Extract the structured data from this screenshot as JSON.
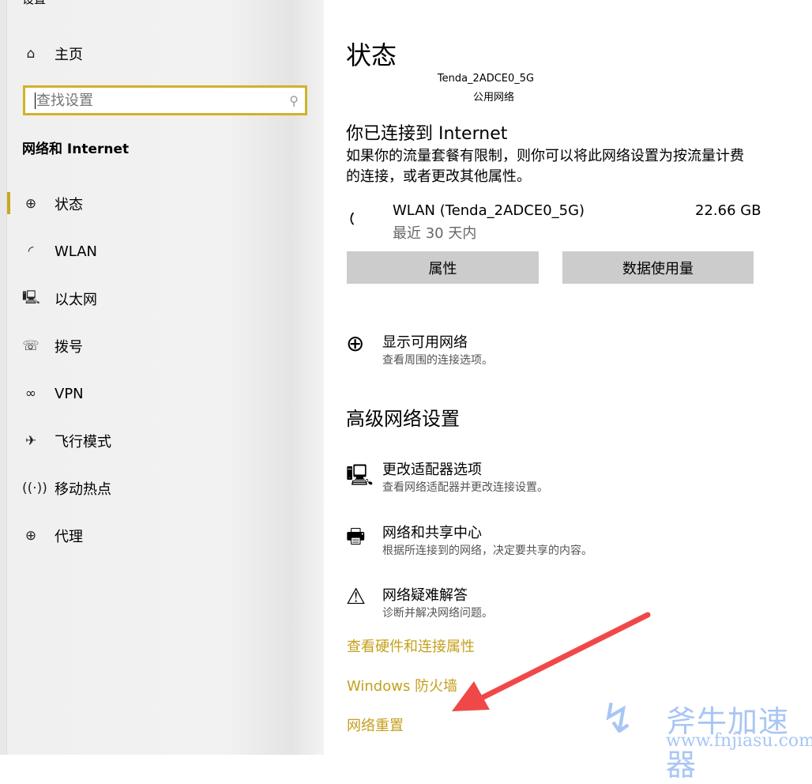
{
  "app": {
    "title": "设置"
  },
  "sidebar": {
    "home": "主页",
    "search_placeholder": "查找设置",
    "section": "网络和 Internet",
    "items": [
      {
        "label": "状态",
        "icon": "globe-icon"
      },
      {
        "label": "WLAN",
        "icon": "wifi-icon"
      },
      {
        "label": "以太网",
        "icon": "ethernet-icon"
      },
      {
        "label": "拨号",
        "icon": "dialup-icon"
      },
      {
        "label": "VPN",
        "icon": "vpn-icon"
      },
      {
        "label": "飞行模式",
        "icon": "airplane-icon"
      },
      {
        "label": "移动热点",
        "icon": "hotspot-icon"
      },
      {
        "label": "代理",
        "icon": "globe-icon"
      }
    ]
  },
  "main": {
    "title": "状态",
    "network_name": "Tenda_2ADCE0_5G",
    "network_type": "公用网络",
    "connected_heading": "你已连接到 Internet",
    "connected_desc": "如果你的流量套餐有限制，则你可以将此网络设置为按流量计费的连接，或者更改其他属性。",
    "usage": {
      "name": "WLAN (Tenda_2ADCE0_5G)",
      "period": "最近 30 天内",
      "amount": "22.66 GB"
    },
    "buttons": {
      "properties": "属性",
      "data_usage": "数据使用量"
    },
    "show_networks": {
      "title": "显示可用网络",
      "sub": "查看周围的连接选项。"
    },
    "advanced_heading": "高级网络设置",
    "advanced": [
      {
        "title": "更改适配器选项",
        "sub": "查看网络适配器并更改连接设置。"
      },
      {
        "title": "网络和共享中心",
        "sub": "根据所连接到的网络，决定要共享的内容。"
      },
      {
        "title": "网络疑难解答",
        "sub": "诊断并解决网络问题。"
      }
    ],
    "links": [
      "查看硬件和连接属性",
      "Windows 防火墙",
      "网络重置"
    ]
  },
  "watermark": {
    "name": "斧牛加速器",
    "url": "www.fnjiasu.com"
  },
  "colors": {
    "accent": "#c5a01c",
    "annotation_arrow": "#f04848"
  }
}
